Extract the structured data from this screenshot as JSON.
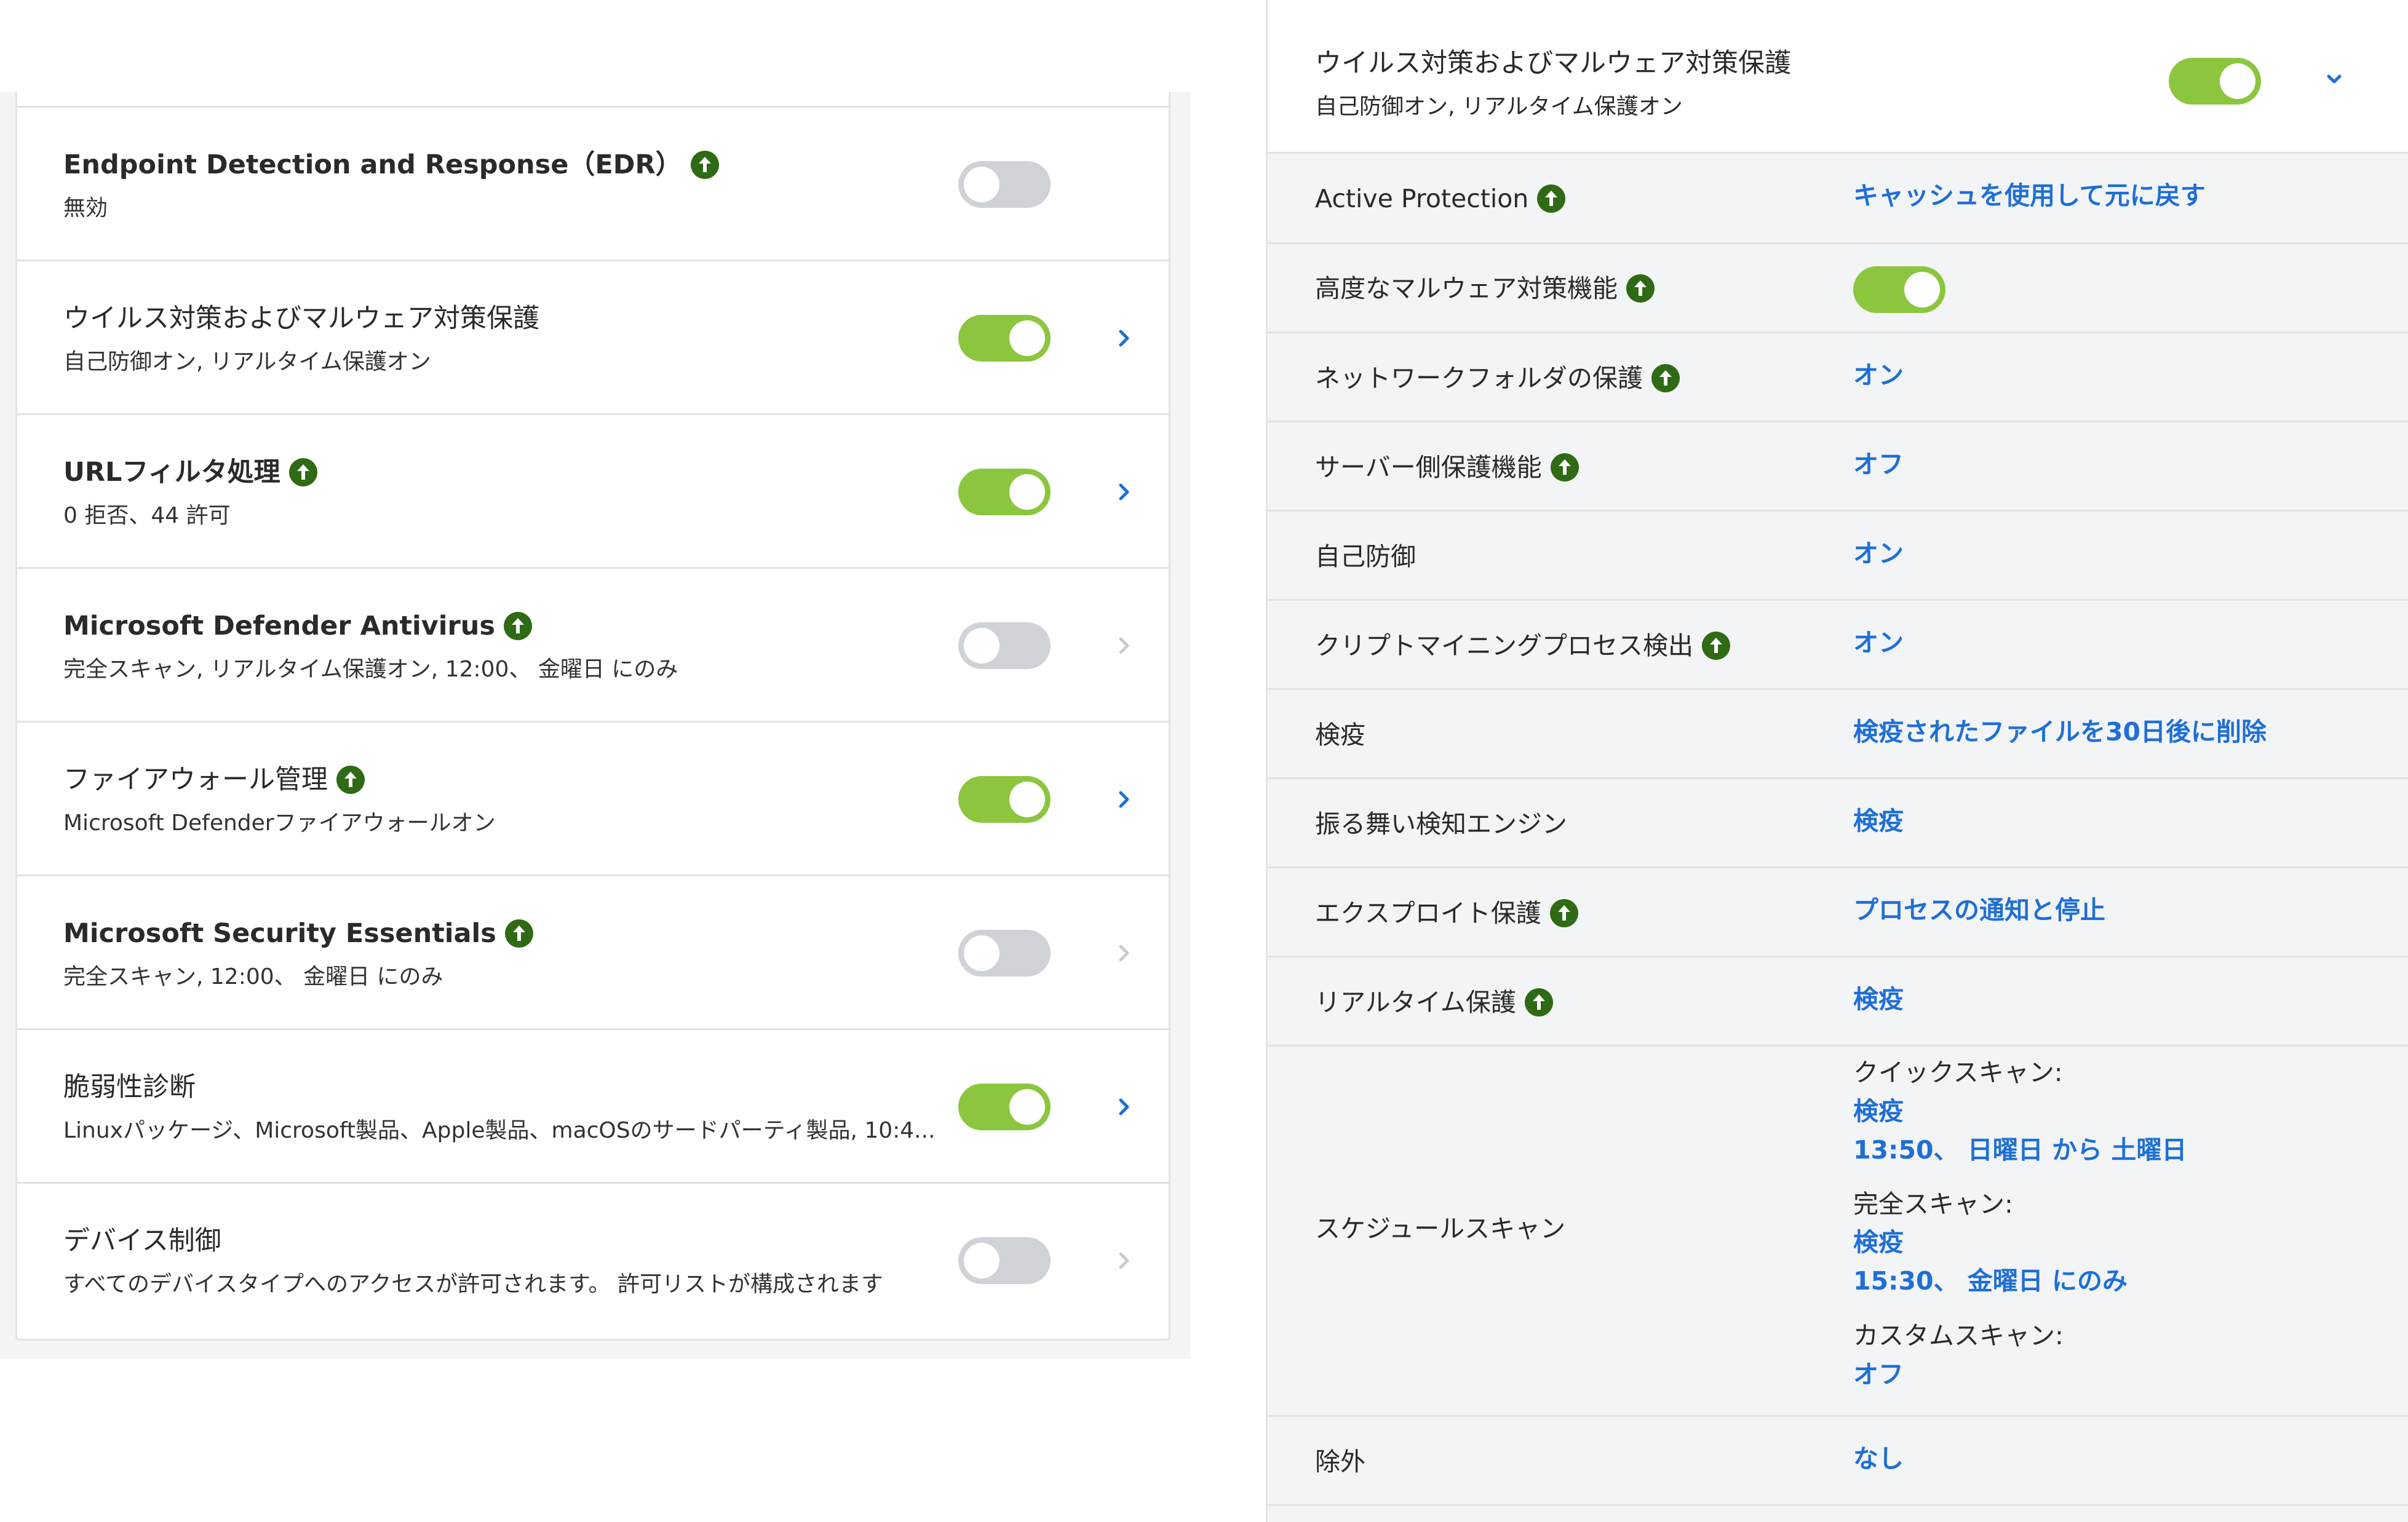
{
  "colors": {
    "toggle_on": "#8cc63f",
    "toggle_off": "#cfd2d6",
    "upgrade_badge": "#2f6a14",
    "link": "#1e6fd6",
    "chevron_active": "#1e6fd6",
    "chevron_disabled": "#c8cbd0"
  },
  "left_list": {
    "items": [
      {
        "title": "Endpoint Detection and Response（EDR）",
        "subtitle": "無効",
        "upgrade_icon": "upgrade-arrow-icon",
        "toggle": "off"
      },
      {
        "title": "ウイルス対策およびマルウェア対策保護",
        "subtitle": "自己防御オン, リアルタイム保護オン",
        "toggle": "on",
        "chevron": "chevron-right-icon"
      },
      {
        "title": "URLフィルタ処理",
        "subtitle": "0 拒否、44 許可",
        "upgrade_icon": "upgrade-arrow-icon",
        "toggle": "on",
        "chevron": "chevron-right-icon"
      },
      {
        "title": "Microsoft Defender Antivirus",
        "subtitle": "完全スキャン, リアルタイム保護オン, 12:00、 金曜日 にのみ",
        "upgrade_icon": "upgrade-arrow-icon",
        "toggle": "off",
        "chevron": "chevron-right-icon"
      },
      {
        "title": "ファイアウォール管理",
        "subtitle": "Microsoft Defenderファイアウォールオン",
        "upgrade_icon": "upgrade-arrow-icon",
        "toggle": "on",
        "chevron": "chevron-right-icon"
      },
      {
        "title": "Microsoft Security Essentials",
        "subtitle": "完全スキャン, 12:00、 金曜日 にのみ",
        "upgrade_icon": "upgrade-arrow-icon",
        "toggle": "off",
        "chevron": "chevron-right-icon"
      },
      {
        "title": "脆弱性診断",
        "subtitle": "Linuxパッケージ、Microsoft製品、Apple製品、macOSのサードパーティ製品, 10:4...",
        "toggle": "on",
        "chevron": "chevron-right-icon"
      },
      {
        "title": "デバイス制御",
        "subtitle": "すべてのデバイスタイプへのアクセスが許可されます。 許可リストが構成されます",
        "toggle": "off",
        "chevron": "chevron-right-icon"
      }
    ]
  },
  "right_panel": {
    "header": {
      "title": "ウイルス対策およびマルウェア対策保護",
      "subtitle": "自己防御オン, リアルタイム保護オン",
      "toggle": "on",
      "chevron": "chevron-down-icon"
    },
    "rows": [
      {
        "label": "Active Protection",
        "value": "キャッシュを使用して元に戻す"
      },
      {
        "label": "高度なマルウェア対策機能",
        "toggle": "on"
      },
      {
        "label": "ネットワークフォルダの保護",
        "value": "オン"
      },
      {
        "label": "サーバー側保護機能",
        "value": "オフ"
      },
      {
        "label": "自己防御",
        "value": "オン"
      },
      {
        "label": "クリプトマイニングプロセス検出",
        "value": "オン"
      },
      {
        "label": "検疫",
        "value": "検疫されたファイルを30日後に削除"
      },
      {
        "label": "振る舞い検知エンジン",
        "value": "検疫"
      },
      {
        "label": "エクスプロイト保護",
        "value": "プロセスの通知と停止"
      },
      {
        "label": "リアルタイム保護",
        "value": "検疫"
      }
    ],
    "schedule": {
      "label": "スケジュールスキャン",
      "quick_label": "クイックスキャン:",
      "quick_action": "検疫",
      "quick_time": "13:50、 日曜日 から 土曜日",
      "full_label": "完全スキャン:",
      "full_action": "検疫",
      "full_time": "15:30、 金曜日 にのみ",
      "custom_label": "カスタムスキャン:",
      "custom_value": "オフ"
    },
    "exclusion": {
      "label": "除外",
      "value": "なし"
    }
  }
}
